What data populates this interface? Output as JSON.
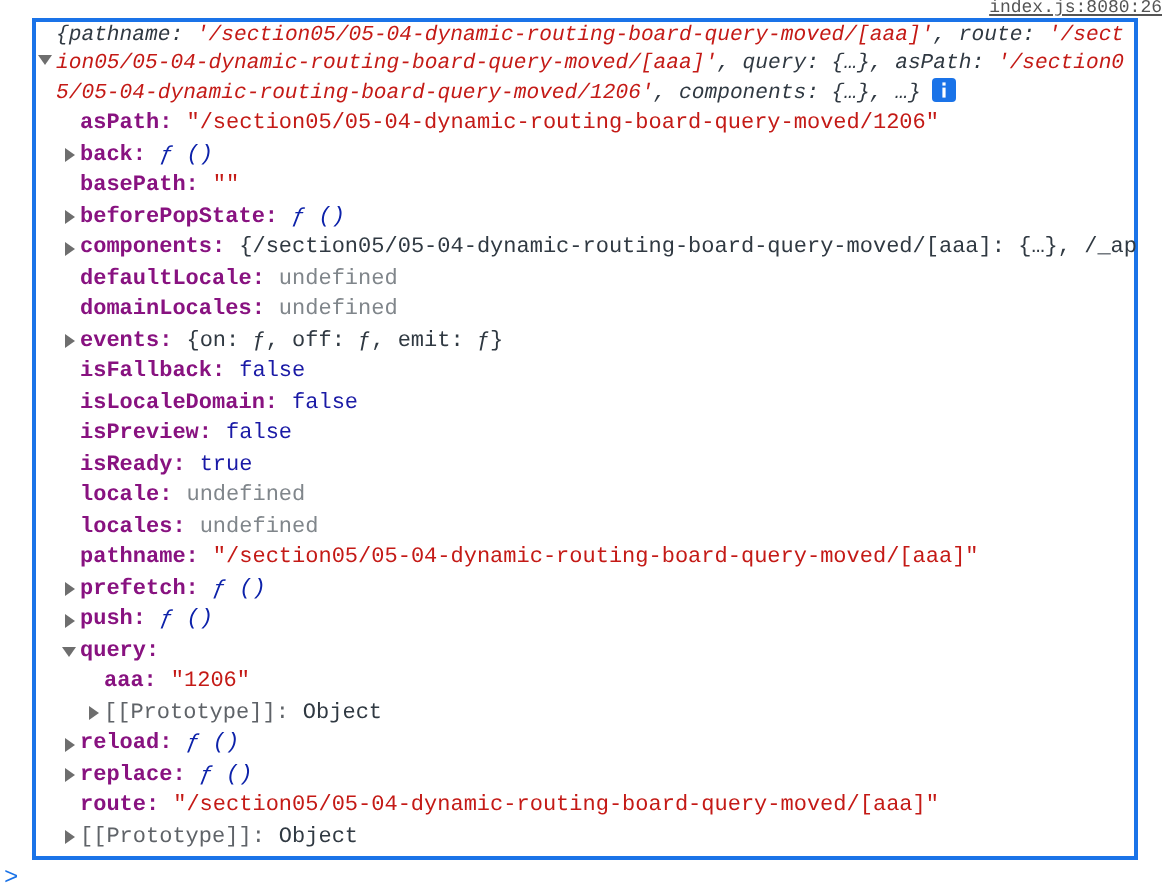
{
  "source_link": "index.js:8080:26",
  "summary": {
    "expanded": true,
    "tokens": [
      {
        "kind": "plain",
        "text": "{pathname: "
      },
      {
        "kind": "string",
        "text": "'/section05/05-04-dynamic-routing-board-query-moved/[aaa]'"
      },
      {
        "kind": "plain",
        "text": ", route: "
      },
      {
        "kind": "string",
        "text": "'/section05/05-04-dynamic-routing-board-query-moved/[aaa]'"
      },
      {
        "kind": "plain",
        "text": ", query: {…}, asPath: "
      },
      {
        "kind": "string",
        "text": "'/section05/05-04-dynamic-routing-board-query-moved/1206'"
      },
      {
        "kind": "plain",
        "text": ", components: {…}, …}"
      }
    ]
  },
  "properties": [
    {
      "key": "asPath:",
      "kind": "string",
      "value": "\"/section05/05-04-dynamic-routing-board-query-moved/1206\""
    },
    {
      "key": "back:",
      "kind": "function",
      "value": "ƒ ()",
      "expandable": true,
      "expanded": false
    },
    {
      "key": "basePath:",
      "kind": "string",
      "value": "\"\""
    },
    {
      "key": "beforePopState:",
      "kind": "function",
      "value": "ƒ ()",
      "expandable": true,
      "expanded": false
    },
    {
      "key": "components:",
      "kind": "object",
      "value": "{/section05/05-04-dynamic-routing-board-query-moved/[aaa]: {…}, /_ap",
      "expandable": true,
      "expanded": false
    },
    {
      "key": "defaultLocale:",
      "kind": "undefined",
      "value": "undefined"
    },
    {
      "key": "domainLocales:",
      "kind": "undefined",
      "value": "undefined"
    },
    {
      "key": "events:",
      "kind": "object",
      "value": "{on: ƒ, off: ƒ, emit: ƒ}",
      "expandable": true,
      "expanded": false
    },
    {
      "key": "isFallback:",
      "kind": "keyword",
      "value": "false"
    },
    {
      "key": "isLocaleDomain:",
      "kind": "keyword",
      "value": "false"
    },
    {
      "key": "isPreview:",
      "kind": "keyword",
      "value": "false"
    },
    {
      "key": "isReady:",
      "kind": "keyword",
      "value": "true"
    },
    {
      "key": "locale:",
      "kind": "undefined",
      "value": "undefined"
    },
    {
      "key": "locales:",
      "kind": "undefined",
      "value": "undefined"
    },
    {
      "key": "pathname:",
      "kind": "string",
      "value": "\"/section05/05-04-dynamic-routing-board-query-moved/[aaa]\""
    },
    {
      "key": "prefetch:",
      "kind": "function",
      "value": "ƒ ()",
      "expandable": true,
      "expanded": false
    },
    {
      "key": "push:",
      "kind": "function",
      "value": "ƒ ()",
      "expandable": true,
      "expanded": false
    },
    {
      "key": "query:",
      "expandable": true,
      "expanded": true,
      "children": [
        {
          "key": "aaa:",
          "kind": "string",
          "value": "\"1206\""
        },
        {
          "key": "[[Prototype]]:",
          "kind": "object",
          "value": "Object",
          "internal": true,
          "expandable": true,
          "expanded": false
        }
      ]
    },
    {
      "key": "reload:",
      "kind": "function",
      "value": "ƒ ()",
      "expandable": true,
      "expanded": false
    },
    {
      "key": "replace:",
      "kind": "function",
      "value": "ƒ ()",
      "expandable": true,
      "expanded": false
    },
    {
      "key": "route:",
      "kind": "string",
      "value": "\"/section05/05-04-dynamic-routing-board-query-moved/[aaa]\""
    },
    {
      "key": "[[Prototype]]:",
      "kind": "object",
      "value": "Object",
      "internal": true,
      "expandable": true,
      "expanded": false
    }
  ],
  "prompt": ">"
}
